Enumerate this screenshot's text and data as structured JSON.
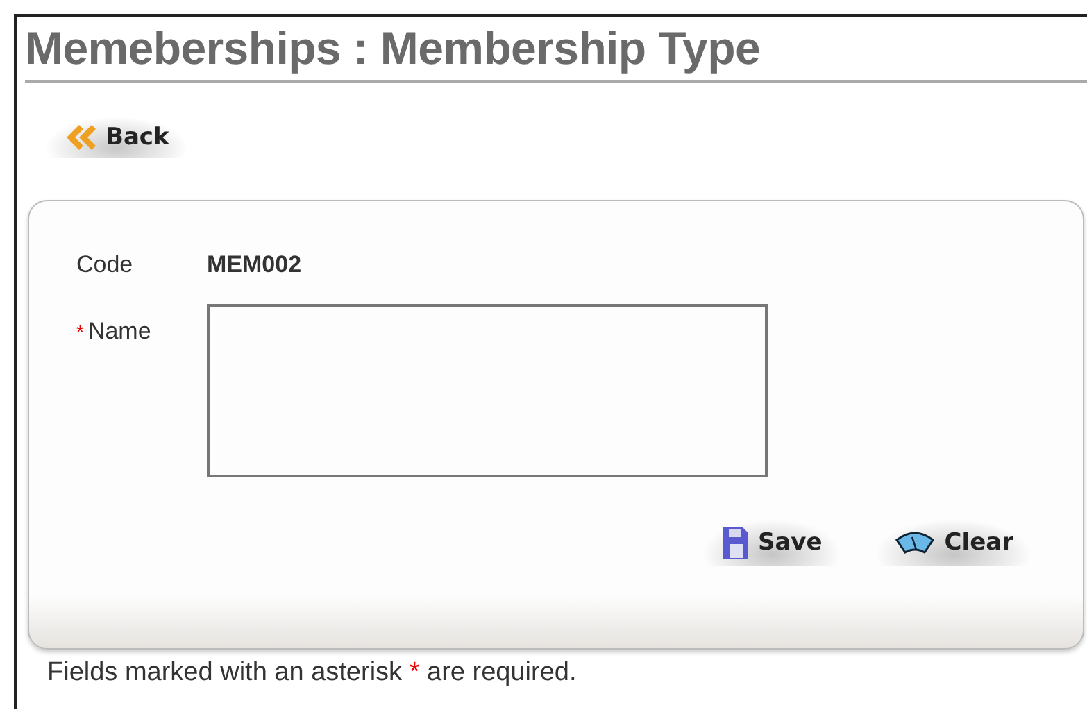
{
  "page": {
    "title": "Memeberships : Membership Type"
  },
  "back_button": {
    "label": "Back"
  },
  "form": {
    "fields": [
      {
        "kind": "static",
        "label": "Code",
        "value": "MEM002"
      },
      {
        "kind": "textarea",
        "label": "Name",
        "required_mark": "*"
      }
    ],
    "buttons": [
      {
        "kind": "save",
        "label": "Save"
      },
      {
        "kind": "clear",
        "label": "Clear"
      }
    ]
  },
  "note": {
    "before": "Fields marked with an asterisk",
    "mark": "*",
    "after": "are required."
  }
}
